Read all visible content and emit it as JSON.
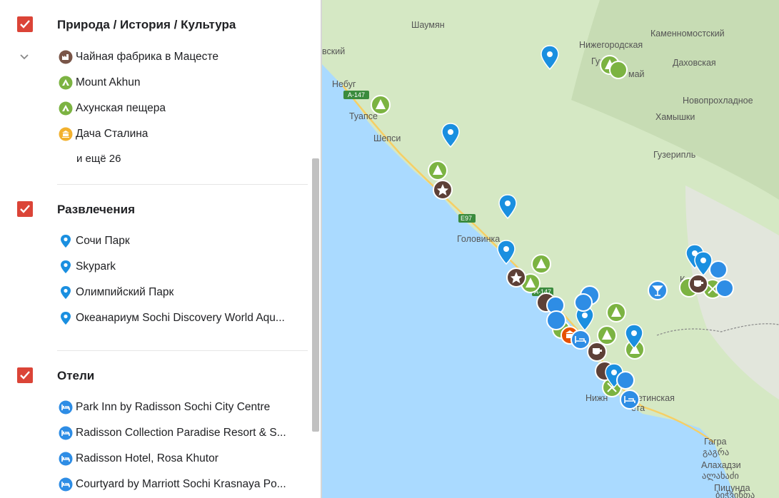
{
  "sidebar": {
    "categories": [
      {
        "title": "Природа / История / Культура",
        "items": [
          {
            "label": "Чайная фабрика в Мацесте",
            "icon": "factory-icon"
          },
          {
            "label": "Mount Akhun",
            "icon": "tent-icon"
          },
          {
            "label": "Ахунская пещера",
            "icon": "tent-icon"
          },
          {
            "label": "Дача Сталина",
            "icon": "museum-icon"
          }
        ],
        "more": "и ещё 26"
      },
      {
        "title": "Развлечения",
        "items": [
          {
            "label": "Сочи Парк",
            "icon": "map-pin-icon"
          },
          {
            "label": "Skypark",
            "icon": "map-pin-icon"
          },
          {
            "label": "Олимпийский Парк",
            "icon": "map-pin-icon"
          },
          {
            "label": "Океанариум Sochi Discovery World Aqu...",
            "icon": "map-pin-icon"
          }
        ]
      },
      {
        "title": "Отели",
        "items": [
          {
            "label": "Park Inn by Radisson Sochi City Centre",
            "icon": "bed-icon"
          },
          {
            "label": "Radisson Collection Paradise Resort & S...",
            "icon": "bed-icon"
          },
          {
            "label": "Radisson Hotel, Rosa Khutor",
            "icon": "bed-icon"
          },
          {
            "label": "Courtyard by Marriott Sochi Krasnaya Po...",
            "icon": "bed-icon"
          }
        ]
      }
    ]
  },
  "map": {
    "place_labels": [
      "Шаумян",
      "Нижегородская",
      "Каменномостский",
      "Даховская",
      "Гуа",
      "май",
      "вский",
      "Небуг",
      "Туапсе",
      "Шепси",
      "Новопрохладное",
      "Хамышки",
      "Гузерипль",
      "Головинка",
      "К",
      "Нижн",
      "етинская",
      "ета",
      "Гагра",
      "გაგრა",
      "Алахадзи",
      "ალახაძი",
      "Пицунда",
      "ბიჭვინთა"
    ],
    "road_labels": [
      "A-147",
      "E97",
      "A-147"
    ]
  },
  "colors": {
    "checkbox": "#db4437",
    "nature": "#7cb342",
    "entertainment": "#1a8fe0",
    "hotel": "#2e8de5",
    "museum": "#f2b12e",
    "dark": "#5d4037",
    "sea": "#aadaff",
    "land": "#d5e8c4"
  }
}
